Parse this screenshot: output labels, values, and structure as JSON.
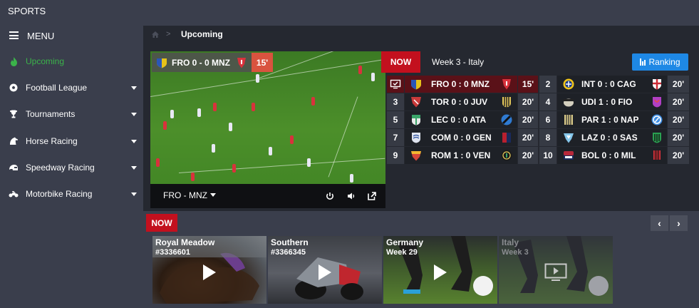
{
  "app": {
    "title": "SPORTS"
  },
  "sidebar": {
    "menu_label": "MENU",
    "items": [
      {
        "label": "Upcoming",
        "icon": "fire-icon",
        "active": true,
        "has_caret": false
      },
      {
        "label": "Football League",
        "icon": "soccer-ball-icon",
        "active": false,
        "has_caret": true
      },
      {
        "label": "Tournaments",
        "icon": "trophy-icon",
        "active": false,
        "has_caret": true
      },
      {
        "label": "Horse Racing",
        "icon": "horse-icon",
        "active": false,
        "has_caret": true
      },
      {
        "label": "Speedway Racing",
        "icon": "helmet-icon",
        "active": false,
        "has_caret": true
      },
      {
        "label": "Motorbike Racing",
        "icon": "motorbike-icon",
        "active": false,
        "has_caret": true
      }
    ]
  },
  "breadcrumb": {
    "current": "Upcoming",
    "separator": ">"
  },
  "video": {
    "score_text": "FRO 0 - 0 MNZ",
    "minute": "15'",
    "match_select": "FRO - MNZ"
  },
  "scores": {
    "now_label": "NOW",
    "week_label": "Week 3 - Italy",
    "ranking_label": "Ranking",
    "games": [
      {
        "num": "",
        "text": "FRO 0 : 0 MNZ",
        "minute": "15'",
        "highlight": true,
        "home_color": "#e6c21a",
        "away_color": "#d9323c"
      },
      {
        "num": "2",
        "text": "INT 0 : 0 CAG",
        "minute": "20'",
        "highlight": false,
        "home_color": "#f0c419",
        "away_color": "#cc2b36"
      },
      {
        "num": "3",
        "text": "TOR 0 : 0 JUV",
        "minute": "20'",
        "highlight": false,
        "home_color": "#c93a3a",
        "away_color": "#e0c55a"
      },
      {
        "num": "4",
        "text": "UDI 1 : 0 FIO",
        "minute": "20'",
        "highlight": false,
        "home_color": "#d4cfbf",
        "away_color": "#b13fc4"
      },
      {
        "num": "5",
        "text": "LEC 0 : 0 ATA",
        "minute": "20'",
        "highlight": false,
        "home_color": "#3aa56a",
        "away_color": "#2f7ad1"
      },
      {
        "num": "6",
        "text": "PAR 1 : 0 NAP",
        "minute": "20'",
        "highlight": false,
        "home_color": "#d8c887",
        "away_color": "#3f8ee3"
      },
      {
        "num": "7",
        "text": "COM 0 : 0 GEN",
        "minute": "20'",
        "highlight": false,
        "home_color": "#dfe4ef",
        "away_color": "#b8202f"
      },
      {
        "num": "8",
        "text": "LAZ 0 : 0 SAS",
        "minute": "20'",
        "highlight": false,
        "home_color": "#86c7eb",
        "away_color": "#2aa051"
      },
      {
        "num": "9",
        "text": "ROM 1 : 0 VEN",
        "minute": "20'",
        "highlight": false,
        "home_color": "#d7463a",
        "away_color": "#1a1a1a"
      },
      {
        "num": "10",
        "text": "BOL 0 : 0 MIL",
        "minute": "20'",
        "highlight": false,
        "home_color": "#b8283a",
        "away_color": "#d9323c"
      }
    ]
  },
  "now_section": {
    "now_label": "NOW",
    "prev_icon": "‹",
    "next_icon": "›",
    "cards": [
      {
        "title": "Royal Meadow",
        "subtitle": "#3336601",
        "dim": false
      },
      {
        "title": "Southern",
        "subtitle": "#3366345",
        "dim": false
      },
      {
        "title": "Germany",
        "subtitle": "Week 29",
        "dim": false
      },
      {
        "title": "Italy",
        "subtitle": "Week 3",
        "dim": true
      }
    ]
  }
}
